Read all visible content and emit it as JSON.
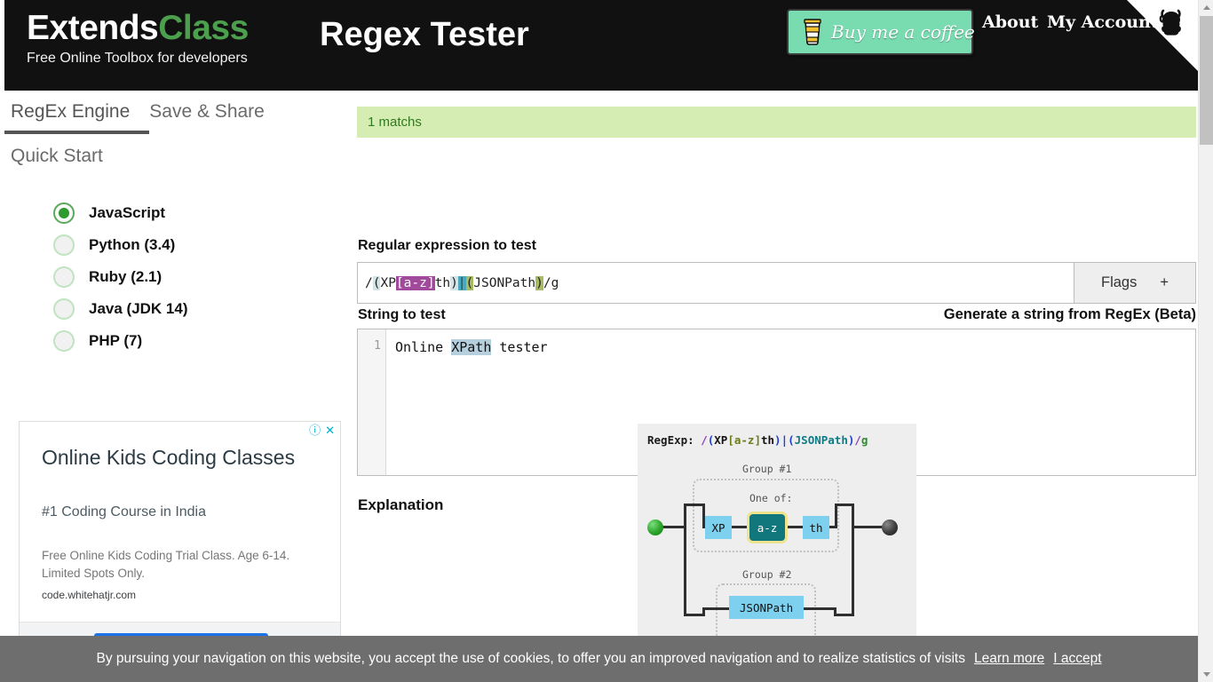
{
  "header": {
    "brand_first": "Extends",
    "brand_second": "Class",
    "brand_tagline": "Free Online Toolbox for developers",
    "page_title": "Regex Tester",
    "coffee_button": "Buy me a coffee",
    "nav": [
      {
        "label": "About"
      },
      {
        "label": "My Account"
      }
    ],
    "github_corner_icon": "github-octocat-icon",
    "coffee_icon": "coffee-cup-icon",
    "brand_accent_color": "#4c9f4c",
    "header_bg_color": "#111111",
    "coffee_button_color": "#79dcb0"
  },
  "sidebar": {
    "tabs": [
      {
        "label": "RegEx Engine",
        "active": true
      },
      {
        "label": "Save & Share",
        "active": false
      }
    ],
    "section_title": "Quick Start",
    "engines": [
      {
        "label": "JavaScript",
        "selected": true
      },
      {
        "label": "Python (3.4)",
        "selected": false
      },
      {
        "label": "Ruby (2.1)",
        "selected": false
      },
      {
        "label": "Java (JDK 14)",
        "selected": false
      },
      {
        "label": "PHP (7)",
        "selected": false
      }
    ],
    "selected_radio_color": "#2e9b2e"
  },
  "ad": {
    "info_icon": "ad-info-icon",
    "close_icon": "ad-close-icon",
    "title": "Online Kids Coding Classes",
    "subtitle": "#1 Coding Course in India",
    "body": "Free Online Kids Coding Trial Class. Age 6-14. Limited Spots Only.",
    "url": "code.whitehatjr.com",
    "cta_color": "#1a73e8"
  },
  "main": {
    "match_status": "1 matchs",
    "match_banner_color": "#d5edb3",
    "regex_label": "Regular expression to test",
    "string_label": "String to test",
    "generate_link": "Generate a string from RegEx (Beta)",
    "explanation_label": "Explanation",
    "flags_button": "Flags",
    "flags_plus": "+",
    "regex": {
      "full": "/(XP[a-z]th)|(JSONPath)/g",
      "tokens": [
        {
          "text": "/",
          "style": "plain"
        },
        {
          "text": "(",
          "style": "paren-a"
        },
        {
          "text": "XP",
          "style": "plain"
        },
        {
          "text": "[a-z]",
          "style": "class"
        },
        {
          "text": "th",
          "style": "plain"
        },
        {
          "text": ")",
          "style": "paren-a"
        },
        {
          "text": "|",
          "style": "alt"
        },
        {
          "text": "(",
          "style": "paren-b"
        },
        {
          "text": "JSONPath",
          "style": "plain"
        },
        {
          "text": ")",
          "style": "paren-b"
        },
        {
          "text": "/g",
          "style": "plain"
        }
      ]
    },
    "test_string": {
      "line_number": "1",
      "before": "Online ",
      "match": "XPath",
      "after": " tester",
      "match_highlight_color": "#b6cfdd"
    }
  },
  "diagram": {
    "regexp_prefix": "RegExp: ",
    "regexp_tokens": [
      {
        "text": "/",
        "color": "slash"
      },
      {
        "text": "(",
        "color": "paren"
      },
      {
        "text": "XP",
        "color": "plain"
      },
      {
        "text": "[a-z]",
        "color": "class"
      },
      {
        "text": "th",
        "color": "plain"
      },
      {
        "text": ")",
        "color": "paren"
      },
      {
        "text": "|",
        "color": "paren"
      },
      {
        "text": "(",
        "color": "paren"
      },
      {
        "text": "JSONPath",
        "color": "lit"
      },
      {
        "text": ")",
        "color": "paren"
      },
      {
        "text": "/",
        "color": "slash"
      },
      {
        "text": "g",
        "color": "flag"
      }
    ],
    "group1_label": "Group #1",
    "group2_label": "Group #2",
    "one_of_label": "One of:",
    "nodes": {
      "xp": "XP",
      "az": "a-z",
      "th": "th",
      "jsonpath": "JSONPath"
    },
    "node_literal_color": "#7ed0ef",
    "node_class_color": "#12777c",
    "node_class_border_color": "#efe38f",
    "start_node_color": "#2ba32b",
    "end_node_color": "#3c3c3c"
  },
  "cookie": {
    "text": "By pursuing your navigation on this website, you accept the use of cookies, to offer you an improved navigation and to realize statistics of visits",
    "learn_more": "Learn more",
    "accept": "I accept",
    "bg_color": "#6e6e6e"
  }
}
